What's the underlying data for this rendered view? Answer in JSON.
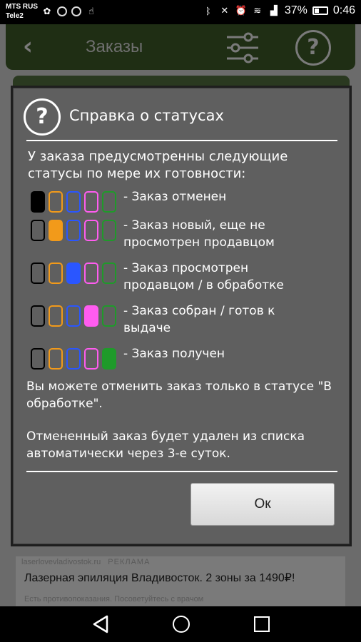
{
  "status_bar": {
    "carrier1": "MTS RUS",
    "carrier2": "Tele2",
    "battery": "37%",
    "time": "0:46"
  },
  "header": {
    "title": "Заказы",
    "back_icon": "back-arrow-icon",
    "filter_icon": "sliders-icon",
    "help_icon": "question-icon"
  },
  "dialog": {
    "title": "Справка о статусах",
    "intro": "У заказа предусмотренны следующие статусы по мере их готовности:",
    "colors": [
      "#000000",
      "#f29a1a",
      "#2a56ff",
      "#ff5cf0",
      "#1f9a2a"
    ],
    "statuses": [
      {
        "label": "- Заказ отменен",
        "active": 0
      },
      {
        "label": "- Заказ новый, еще не просмотрен продавцом",
        "active": 1
      },
      {
        "label": "- Заказ просмотрен продавцом / в обработке",
        "active": 2
      },
      {
        "label": "- Заказ собран / готов к выдаче",
        "active": 3
      },
      {
        "label": "- Заказ получен",
        "active": 4
      }
    ],
    "note_cancel": "Вы можете отменить заказ только в статусе \"В обработке\".",
    "note_delete": "Отмененный заказ будет удален из списка автоматически через 3-е суток.",
    "ok_label": "Ок"
  },
  "ad": {
    "domain": "laserlovevladivostok.ru",
    "label": "РЕКЛАМА",
    "title": "Лазерная эпиляция Владивосток. 2 зоны за 1490₽!",
    "disclaimer": "Есть противопоказания. Посоветуйтесь с врачом"
  }
}
